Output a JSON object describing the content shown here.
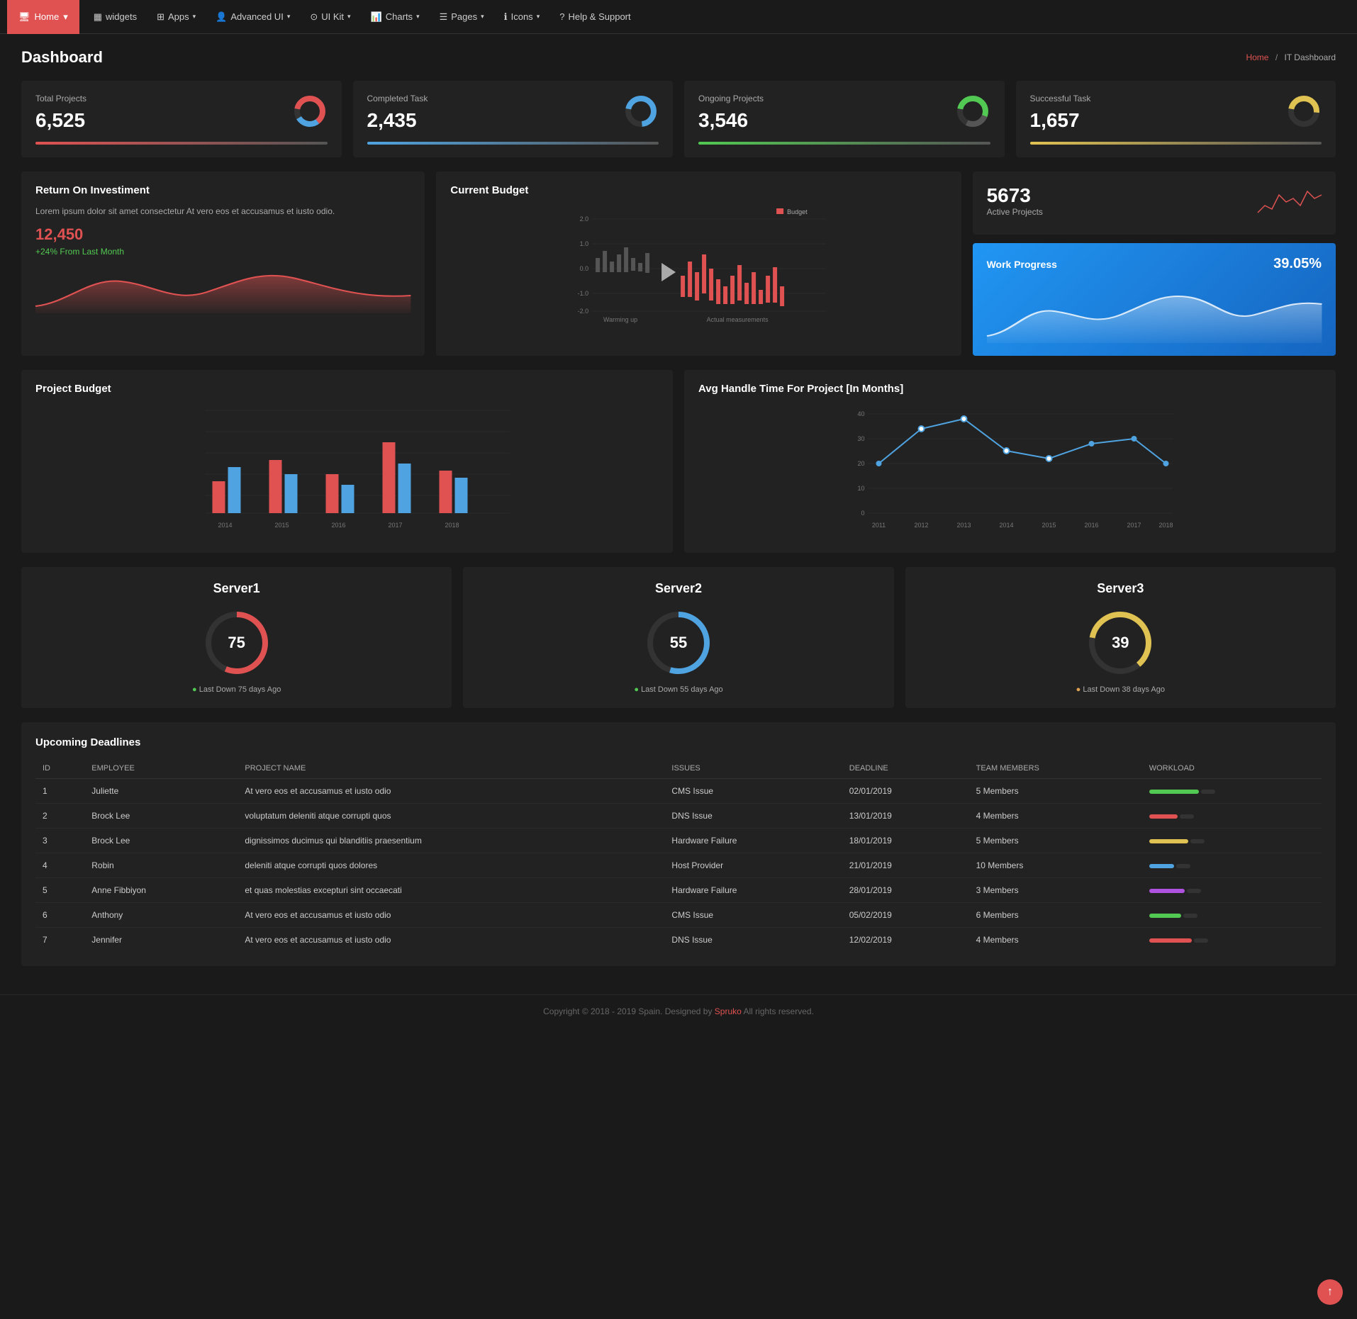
{
  "navbar": {
    "home_label": "Home",
    "widgets_label": "widgets",
    "apps_label": "Apps",
    "advanced_ui_label": "Advanced UI",
    "ui_kit_label": "UI Kit",
    "charts_label": "Charts",
    "pages_label": "Pages",
    "icons_label": "Icons",
    "help_label": "Help & Support"
  },
  "breadcrumb": {
    "home": "Home",
    "separator": "/",
    "current": "IT Dashboard"
  },
  "page_title": "Dashboard",
  "stat_cards": [
    {
      "label": "Total Projects",
      "value": "6,525",
      "bar_class": "bar-red"
    },
    {
      "label": "Completed Task",
      "value": "2,435",
      "bar_class": "bar-blue"
    },
    {
      "label": "Ongoing Projects",
      "value": "3,546",
      "bar_class": "bar-green"
    },
    {
      "label": "Successful Task",
      "value": "1,657",
      "bar_class": "bar-yellow"
    }
  ],
  "roi": {
    "title": "Return On Investiment",
    "text": "Lorem ipsum dolor sit amet consectetur At vero eos et accusamus et iusto odio.",
    "value": "12,450",
    "growth": "+24%  From Last Month"
  },
  "current_budget": {
    "title": "Current Budget",
    "legend": "Budget"
  },
  "active_projects": {
    "number": "5673",
    "label": "Active Projects"
  },
  "work_progress": {
    "title": "Work Progress",
    "percentage": "39.05%"
  },
  "project_budget": {
    "title": "Project Budget",
    "years": [
      "2014",
      "2015",
      "2016",
      "2017",
      "2018"
    ]
  },
  "avg_handle_time": {
    "title": "Avg Handle Time For Project [In Months]",
    "years": [
      "2011",
      "2012",
      "2013",
      "2014",
      "2015",
      "2016",
      "2017",
      "2018"
    ],
    "y_labels": [
      "0",
      "10",
      "20",
      "30",
      "40"
    ]
  },
  "servers": [
    {
      "name": "Server1",
      "value": 75,
      "status_icon": "green",
      "status": "Last Down 75 days Ago",
      "color": "#e05252"
    },
    {
      "name": "Server2",
      "value": 55,
      "status_icon": "green",
      "status": "Last Down 55 days Ago",
      "color": "#4fa3e0"
    },
    {
      "name": "Server3",
      "value": 39,
      "status_icon": "orange",
      "status": "Last Down 38 days Ago",
      "color": "#e0c252"
    }
  ],
  "table": {
    "title": "Upcoming Deadlines",
    "headers": [
      "ID",
      "EMPLOYEE",
      "PROJECT NAME",
      "ISSUES",
      "DEADLINE",
      "TEAM MEMBERS",
      "WORKLOAD"
    ],
    "rows": [
      {
        "id": 1,
        "employee": "Juliette",
        "project": "At vero eos et accusamus et iusto odio",
        "issue": "CMS Issue",
        "deadline": "02/01/2019",
        "team": "5 Members",
        "workload_color": "#52c952",
        "workload_pct": 70
      },
      {
        "id": 2,
        "employee": "Brock Lee",
        "project": "voluptatum deleniti atque corrupti quos",
        "issue": "DNS Issue",
        "deadline": "13/01/2019",
        "team": "4 Members",
        "workload_color": "#e05252",
        "workload_pct": 40
      },
      {
        "id": 3,
        "employee": "Brock Lee",
        "project": "dignissimos ducimus qui blanditiis praesentium",
        "issue": "Hardware Failure",
        "deadline": "18/01/2019",
        "team": "5 Members",
        "workload_color": "#e0c252",
        "workload_pct": 55
      },
      {
        "id": 4,
        "employee": "Robin",
        "project": "deleniti atque corrupti quos dolores",
        "issue": "Host Provider",
        "deadline": "21/01/2019",
        "team": "10 Members",
        "workload_color": "#4fa3e0",
        "workload_pct": 35
      },
      {
        "id": 5,
        "employee": "Anne Fibbiyon",
        "project": "et quas molestias excepturi sint occaecati",
        "issue": "Hardware Failure",
        "deadline": "28/01/2019",
        "team": "3 Members",
        "workload_color": "#b052e0",
        "workload_pct": 50
      },
      {
        "id": 6,
        "employee": "Anthony",
        "project": "At vero eos et accusamus et iusto odio",
        "issue": "CMS Issue",
        "deadline": "05/02/2019",
        "team": "6 Members",
        "workload_color": "#52c952",
        "workload_pct": 45
      },
      {
        "id": 7,
        "employee": "Jennifer",
        "project": "At vero eos et accusamus et iusto odio",
        "issue": "DNS Issue",
        "deadline": "12/02/2019",
        "team": "4 Members",
        "workload_color": "#e05252",
        "workload_pct": 60
      }
    ]
  },
  "footer": {
    "text": "Copyright © 2018 - 2019 Spain. Designed by ",
    "brand": "Spruko",
    "suffix": "All rights reserved."
  }
}
